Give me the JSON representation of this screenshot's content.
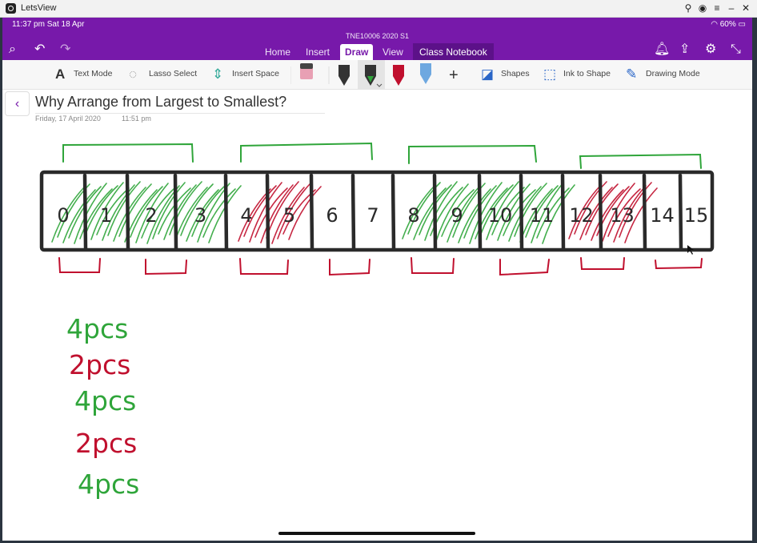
{
  "window": {
    "app_name": "LetsView"
  },
  "status_bar": {
    "time": "11:37 pm  Sat 18 Apr",
    "battery": "60%"
  },
  "header": {
    "doc_title": "TNE10006 2020 S1",
    "tabs": [
      "Home",
      "Insert",
      "Draw",
      "View",
      "Class Notebook"
    ],
    "active_tab": "Draw"
  },
  "toolbar": {
    "text_mode": "Text Mode",
    "lasso_select": "Lasso Select",
    "insert_space": "Insert Space",
    "shapes": "Shapes",
    "ink_to_shape": "Ink to Shape",
    "drawing_mode": "Drawing Mode"
  },
  "page": {
    "title": "Why Arrange from Largest to Smallest?",
    "date": "Friday, 17 April 2020",
    "time": "11:51 pm"
  },
  "ink": {
    "cell_numbers": [
      "0",
      "1",
      "2",
      "3",
      "4",
      "5",
      "6",
      "7",
      "8",
      "9",
      "10",
      "11",
      "12",
      "13",
      "14",
      "15"
    ],
    "notes": [
      "4pcs",
      "2pcs",
      "4pcs",
      "2pcs",
      "4pcs"
    ],
    "colors": {
      "green": "#2fa53a",
      "red": "#c0102e",
      "black": "#2a2a2a"
    }
  }
}
